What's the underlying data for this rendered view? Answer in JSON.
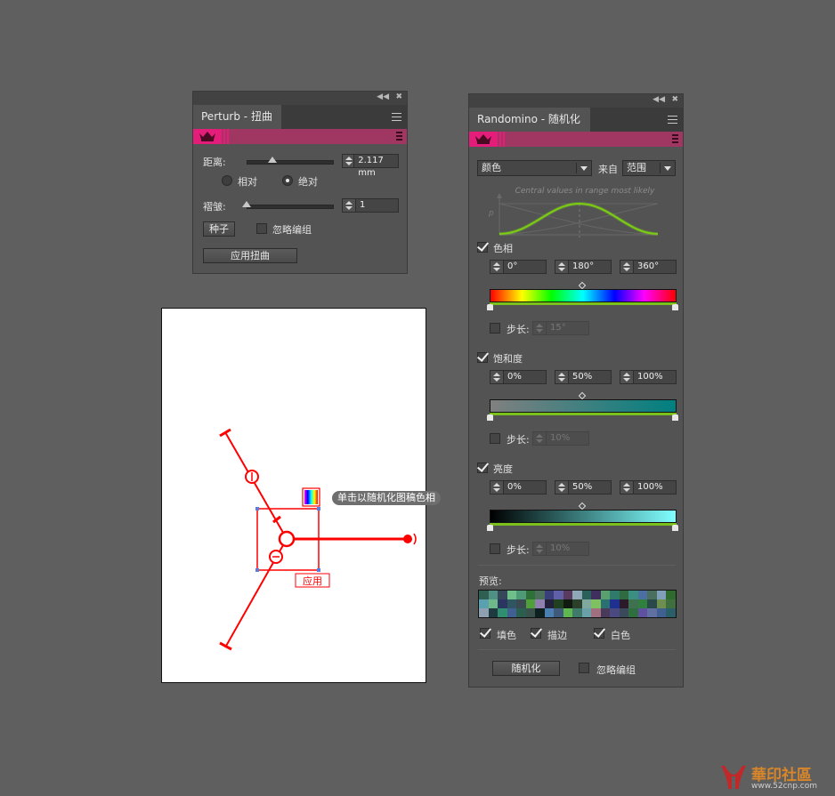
{
  "perturb": {
    "title": "Perturb - 扭曲",
    "distance_label": "距离:",
    "distance_value": "2.117 mm",
    "distance_slider_fraction": 0.3,
    "relative_label": "相对",
    "absolute_label": "绝对",
    "selected_mode": "absolute",
    "wrinkle_label": "褶皱:",
    "wrinkle_value": "1",
    "wrinkle_slider_fraction": 0.0,
    "seed_button": "种子",
    "ignore_groups_label": "忽略编组",
    "ignore_groups_checked": false,
    "apply_button": "应用扭曲"
  },
  "randomino": {
    "title": "Randomino - 随机化",
    "property_select": "颜色",
    "from_label": "来自",
    "source_select": "范围",
    "distribution_caption": "Central values in range most likely",
    "distribution_axis_label": "p",
    "hue": {
      "label": "色相",
      "checked": true,
      "min": "0°",
      "mid": "180°",
      "max": "360°",
      "step_label": "步长:",
      "step_checked": false,
      "step_value": "15°"
    },
    "saturation": {
      "label": "饱和度",
      "checked": true,
      "min": "0%",
      "mid": "50%",
      "max": "100%",
      "step_label": "步长:",
      "step_checked": false,
      "step_value": "10%"
    },
    "brightness": {
      "label": "亮度",
      "checked": true,
      "min": "0%",
      "mid": "50%",
      "max": "100%",
      "step_label": "步长:",
      "step_checked": false,
      "step_value": "10%"
    },
    "preview_label": "预览:",
    "preview_colors": [
      "#2f5e52",
      "#4f8f84",
      "#37475a",
      "#6fbf8a",
      "#4f9a76",
      "#2f6f38",
      "#4a6f5a",
      "#3a3f7a",
      "#5f60a8",
      "#5a3a5f",
      "#8fa8b8",
      "#2a5f5a",
      "#3f2f5f",
      "#5aa06f",
      "#2f7a6a",
      "#2f6a40",
      "#3a8f80",
      "#4a6fa0",
      "#4a6f5f",
      "#7fa0b8",
      "#2f6a2f",
      "#5aa0b0",
      "#6fb88a",
      "#2a3560",
      "#2f5560",
      "#3a4a50",
      "#4f9f3a",
      "#8f80b0",
      "#22203a",
      "#204020",
      "#101a10",
      "#2a402a",
      "#7fa89f",
      "#7fc060",
      "#2a7070",
      "#203090",
      "#2a1a2a",
      "#3f7050",
      "#2f7f3f",
      "#2a4a4a",
      "#6f8f50",
      "#3f6f3f",
      "#8fa0b0",
      "#1f3a40",
      "#2f8f70",
      "#3f6090",
      "#2a5f50",
      "#3a504a",
      "#0f2020",
      "#4a7fb0",
      "#3f5a7a",
      "#5fb84f",
      "#3f7a6a",
      "#6aa0a8",
      "#a07080",
      "#4a3a5a",
      "#4a4a80",
      "#3a4a5a",
      "#2f6f3f",
      "#6050a0",
      "#6070a0",
      "#3f6090",
      "#2a5f6a",
      "#1f4a2a",
      "#8fa070",
      "#1f6a7a"
    ],
    "fill_label": "填色",
    "fill_checked": true,
    "stroke_label": "描边",
    "stroke_checked": true,
    "white_label": "白色",
    "white_checked": true,
    "randomize_button": "随机化",
    "ignore_groups_label": "忽略编组",
    "ignore_groups_checked": false
  },
  "canvas": {
    "tooltip": "单击以随机化图稿色相",
    "apply_label": "应用",
    "accent_color": "#ff0000"
  },
  "watermark": {
    "name": "華印社區",
    "url": "www.52cnp.com"
  }
}
